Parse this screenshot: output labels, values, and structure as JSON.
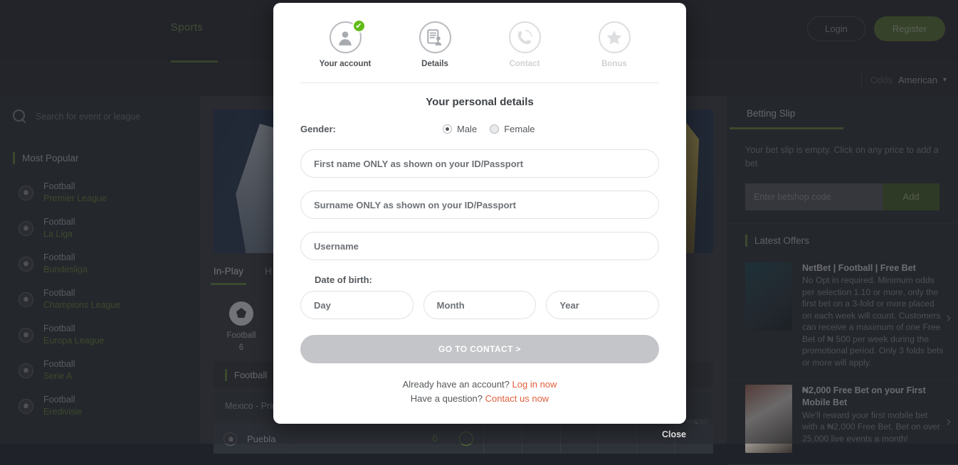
{
  "topnav": {
    "sports_tab": "Sports",
    "login_label": "Login",
    "register_label": "Register"
  },
  "subbar": {
    "odds_label": "Odds",
    "odds_value": "American",
    "chevron": "▾"
  },
  "sidebar": {
    "search_placeholder": "Search for event or league",
    "section_title": "Most Popular",
    "leagues": [
      {
        "sport": "Football",
        "name": "Premier League"
      },
      {
        "sport": "Football",
        "name": "La Liga"
      },
      {
        "sport": "Football",
        "name": "Bundesliga"
      },
      {
        "sport": "Football",
        "name": "Champions League"
      },
      {
        "sport": "Football",
        "name": "Europa League"
      },
      {
        "sport": "Football",
        "name": "Serie A"
      },
      {
        "sport": "Football",
        "name": "Eredivisie"
      }
    ]
  },
  "main": {
    "tabs": [
      {
        "label": "In-Play",
        "active": true
      },
      {
        "label": "H",
        "active": false
      }
    ],
    "sport_chip": {
      "name": "Football",
      "count": "6"
    },
    "section_band": "Football",
    "league_band": "Mexico - Prim",
    "match": {
      "team": "Puebla",
      "score": "0",
      "live": "⏻",
      "odds": [
        "",
        "",
        "",
        "",
        "",
        ""
      ]
    },
    "next_arrow": "›"
  },
  "rightpanel": {
    "slip_tab": "Betting Slip",
    "slip_empty": "Your bet slip is empty. Click on any price to add a bet",
    "betshop_placeholder": "Enter betshop code",
    "add_label": "Add",
    "offers_title": "Latest Offers",
    "offers": [
      {
        "title": "NetBet | Football | Free Bet",
        "desc": "No Opt in required. Minimum odds per selection 1.10 or more, only the first bet on a 3-fold or more placed on each week will count. Customers can receive a maximum of one Free Bet of ₦ 500 per week during the promotional period. Only 3 folds bets or more will apply.",
        "chevron": "›"
      },
      {
        "title": "₦2,000 Free Bet on your First Mobile Bet",
        "desc": "We'll reward your first mobile bet with a ₦2,000 Free Bet. Bet on over 25,000 live events a month!",
        "chevron": "›"
      }
    ]
  },
  "overlay": {
    "close_label": "Close"
  },
  "modal": {
    "steps": [
      {
        "label": "Your account",
        "icon": "user-icon",
        "state": "complete"
      },
      {
        "label": "Details",
        "icon": "document-icon",
        "state": "active"
      },
      {
        "label": "Contact",
        "icon": "phone-icon",
        "state": "inactive"
      },
      {
        "label": "Bonus",
        "icon": "star-icon",
        "state": "inactive"
      }
    ],
    "check_glyph": "✔",
    "title": "Your personal details",
    "gender_label": "Gender:",
    "gender_options": [
      {
        "label": "Male",
        "selected": true
      },
      {
        "label": "Female",
        "selected": false
      }
    ],
    "first_name_placeholder": "First name ONLY as shown on your ID/Passport",
    "surname_placeholder": "Surname ONLY as shown on your ID/Passport",
    "username_placeholder": "Username",
    "dob_label": "Date of birth:",
    "dob": {
      "day_placeholder": "Day",
      "month_placeholder": "Month",
      "year_placeholder": "Year"
    },
    "cta_label": "GO TO CONTACT >",
    "footer": {
      "account_text": "Already have an account?",
      "login_link": "Log in now",
      "question_text": "Have a question?",
      "contact_link": "Contact us now"
    }
  },
  "colors": {
    "accent_green": "#5d7c2c",
    "check_green": "#62bb17",
    "link_orange": "#e0603c",
    "modal_bg": "#ffffff",
    "app_bg": "#1f2228"
  }
}
